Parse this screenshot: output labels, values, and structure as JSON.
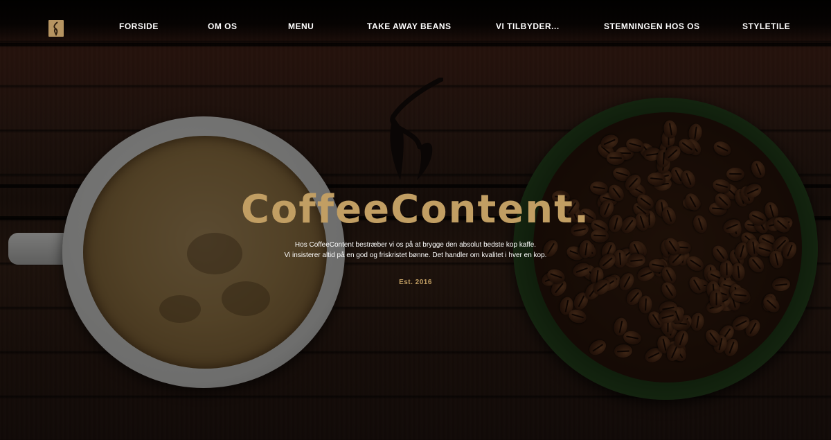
{
  "brand": {
    "name": "CoffeeContent.",
    "tagline_line1": "Hos CoffeeContent bestræber vi os på at brygge den absolut bedste kop kaffe.",
    "tagline_line2": "Vi insisterer altid på en god og friskristet bønne. Det handler om kvalitet i hver en kop.",
    "established": "Est. 2016"
  },
  "nav": {
    "items": [
      {
        "label": "FORSIDE"
      },
      {
        "label": "OM OS"
      },
      {
        "label": "MENU"
      },
      {
        "label": "TAKE AWAY BEANS"
      },
      {
        "label": "VI TILBYDER..."
      },
      {
        "label": "STEMNINGEN HOS OS"
      },
      {
        "label": "STYLETILE"
      }
    ]
  },
  "icons": {
    "nav_logo": "coffee-steam-logo-icon",
    "hero_logo": "coffee-steam-logo-icon"
  },
  "colors": {
    "accent": "#c19e63",
    "nav_text": "#ffffff",
    "body_text": "#ffffff"
  }
}
